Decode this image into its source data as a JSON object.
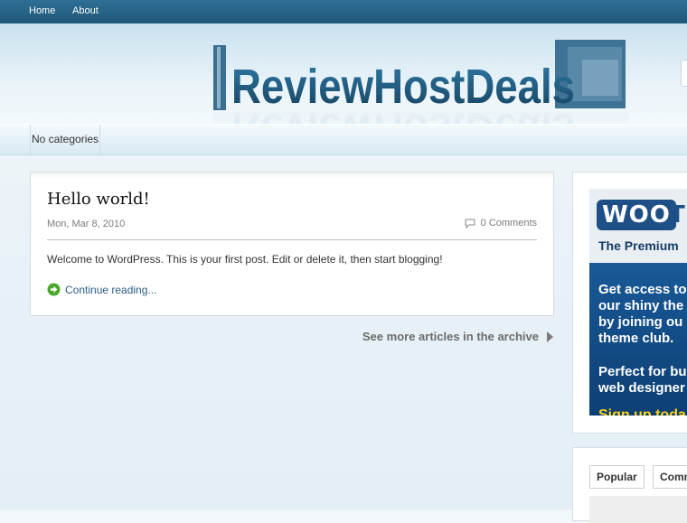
{
  "nav": {
    "home": "Home",
    "about": "About"
  },
  "logo": {
    "text": "ReviewHostDeals"
  },
  "categories": {
    "label": "No categories"
  },
  "post": {
    "title": "Hello world!",
    "date": "Mon, Mar 8, 2010",
    "comments": "0 Comments",
    "body": "Welcome to WordPress. This is your first post. Edit or delete it, then start blogging!",
    "more": "Continue reading..."
  },
  "archive": {
    "label": "See more articles in the archive"
  },
  "ad": {
    "brand_a": "WOO",
    "brand_b": "TH",
    "premium": "The Premium",
    "lines_1": "Get access to\nour shiny the\nby joining ou\ntheme club.",
    "lines_2": "Perfect for bu\nweb designer",
    "signup": "Sign up toda"
  },
  "tabs": {
    "popular": "Popular",
    "comments": "Comm"
  },
  "colors": {
    "nav_bg": "#1f5878",
    "link": "#2a5d86",
    "ad_blue": "#1e66a8",
    "ad_yellow": "#ffd21c",
    "logo_blue": "#1c4f72"
  }
}
